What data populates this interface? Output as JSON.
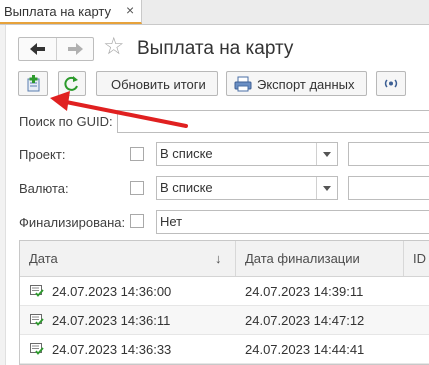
{
  "tab": {
    "title": "Выплата на карту",
    "close": "×"
  },
  "form": {
    "title": "Выплата на карту"
  },
  "toolbar": {
    "refresh_totals": "Обновить итоги",
    "export_data": "Экспорт данных"
  },
  "filters": {
    "guid": {
      "label": "Поиск по GUID:",
      "value": ""
    },
    "project": {
      "label": "Проект:",
      "mode": "В списке",
      "value": ""
    },
    "currency": {
      "label": "Валюта:",
      "mode": "В списке",
      "value": ""
    },
    "finalized": {
      "label": "Финализирована:",
      "value": "Нет"
    }
  },
  "table": {
    "columns": [
      "Дата",
      "Дата финализации",
      "ID"
    ],
    "sort_indicator": "↓",
    "rows": [
      {
        "date": "24.07.2023 14:36:00",
        "final_date": "24.07.2023 14:39:11"
      },
      {
        "date": "24.07.2023 14:36:11",
        "final_date": "24.07.2023 14:47:12"
      },
      {
        "date": "24.07.2023 14:36:33",
        "final_date": "24.07.2023 14:44:41"
      }
    ]
  },
  "colors": {
    "accent_tab": "#e7a23b",
    "annotation_arrow": "#e02020",
    "refresh_green": "#2c9a2c"
  }
}
